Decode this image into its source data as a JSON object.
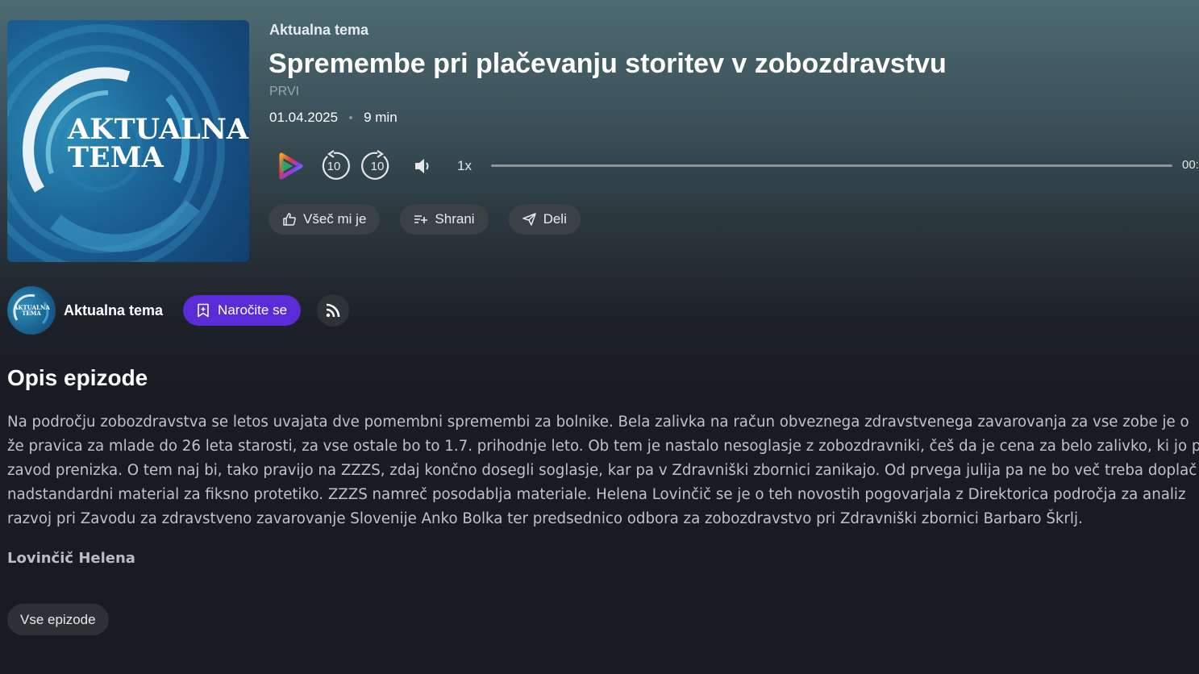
{
  "episode": {
    "show_name": "Aktualna tema",
    "title": "Spremembe pri plačevanju storitev v zobozdravstvu",
    "channel": "PRVI",
    "date": "01.04.2025",
    "duration": "9 min",
    "cover_text_line1": "AKTUALNA",
    "cover_text_line2": "TEMA"
  },
  "player": {
    "rewind_label": "10",
    "forward_label": "10",
    "speed": "1x",
    "time": "00:",
    "progress": 0
  },
  "actions": {
    "like_label": "Všeč mi je",
    "save_label": "Shrani",
    "share_label": "Deli"
  },
  "show": {
    "name": "Aktualna tema",
    "avatar_text": "AKTUALNA TEMA",
    "subscribe_label": "Naročite se"
  },
  "description": {
    "heading": "Opis epizode",
    "lines": [
      "Na področju zobozdravstva se letos uvajata dve pomembni spremembi za bolnike. Bela zalivka na račun obveznega zdravstvenega zavarovanja za vse zobe je o",
      "že pravica za mlade do 26 leta starosti, za vse ostale bo to 1.7. prihodnje leto. Ob tem je nastalo nesoglasje z zobozdravniki, češ da je cena za belo zalivko, ki jo p",
      "zavod prenizka. O tem naj bi, tako pravijo na ZZZS, zdaj končno dosegli soglasje, kar pa v Zdravniški zbornici zanikajo. Od prvega julija pa ne bo več treba doplač",
      "nadstandardni material za fiksno protetiko. ZZZS namreč posodablja materiale. Helena Lovinčič se je o teh novostih pogovarjala z Direktorica področja za analiz",
      "razvoj pri Zavodu za zdravstveno zavarovanje Slovenije Anko Bolka ter predsednico odbora za zobozdravstvo pri Zdravniški zbornici Barbaro Škrlj."
    ],
    "author": "Lovinčič Helena"
  },
  "footer": {
    "all_episodes_label": "Vse epizode"
  },
  "colors": {
    "accent": "#5a2bd6",
    "pill_bg": "#3a4246",
    "page_bg": "#181b21"
  },
  "icons": [
    "play-icon",
    "rewind-10-icon",
    "forward-10-icon",
    "volume-icon",
    "thumbs-up-icon",
    "add-to-list-icon",
    "send-icon",
    "bookmark-icon",
    "rss-icon"
  ]
}
